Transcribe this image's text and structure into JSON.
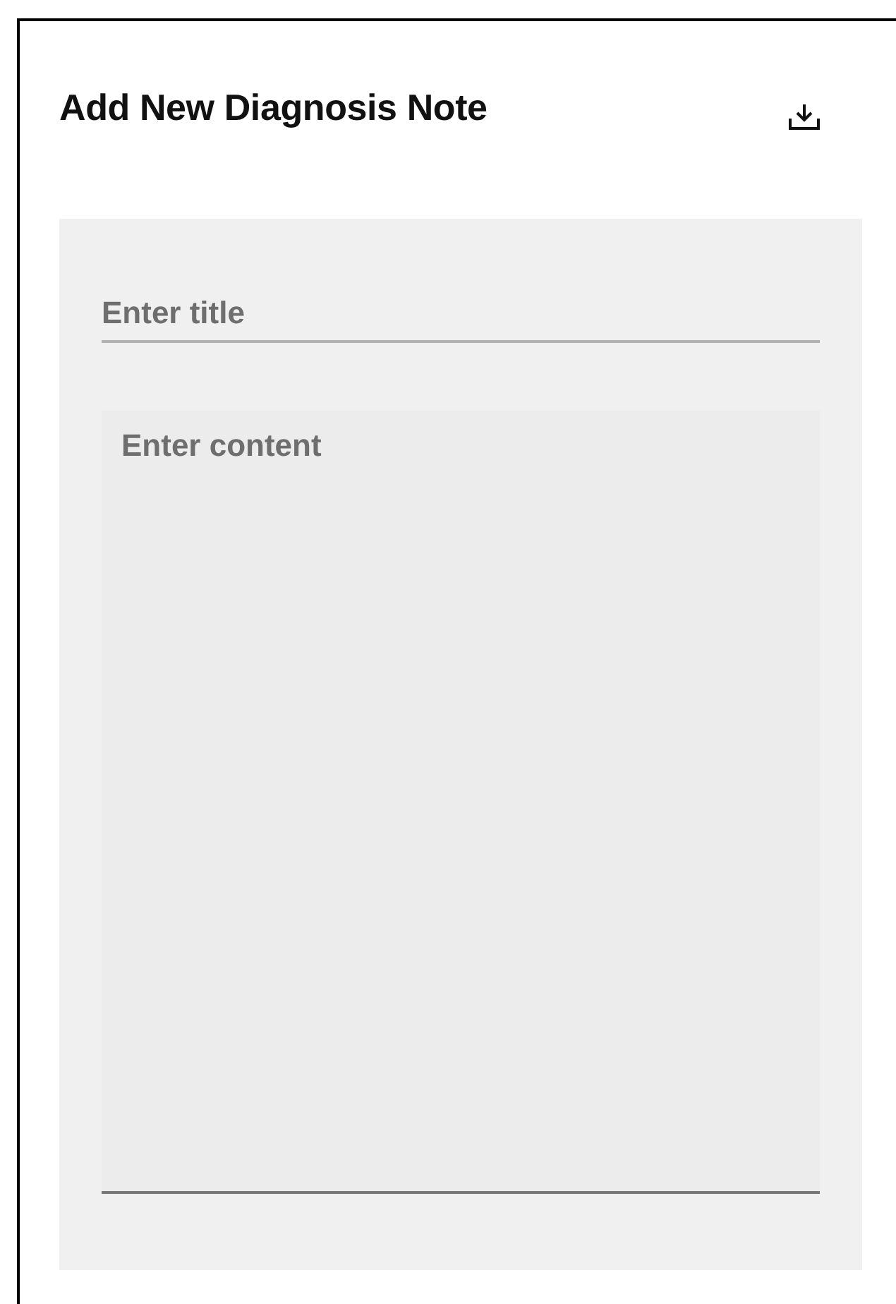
{
  "header": {
    "title": "Add New Diagnosis Note"
  },
  "form": {
    "title_field": {
      "placeholder": "Enter title"
    },
    "content_field": {
      "placeholder": "Enter content"
    }
  }
}
